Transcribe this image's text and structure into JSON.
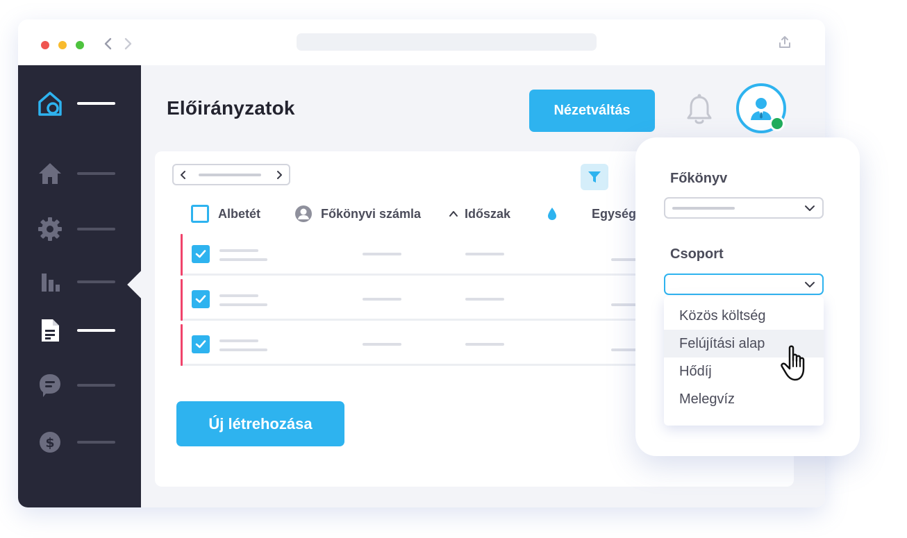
{
  "header": {
    "title": "Előirányzatok",
    "view_button": "Nézetváltás"
  },
  "sidebar": {
    "items": [
      {
        "name": "logo",
        "icon": "home-logo-icon"
      },
      {
        "name": "home",
        "icon": "house-icon"
      },
      {
        "name": "settings",
        "icon": "gear-icon"
      },
      {
        "name": "charts",
        "icon": "bar-chart-icon"
      },
      {
        "name": "documents",
        "icon": "document-icon",
        "active": true
      },
      {
        "name": "messages",
        "icon": "chat-icon"
      },
      {
        "name": "finance",
        "icon": "dollar-icon"
      }
    ]
  },
  "table": {
    "columns": [
      "Albetét",
      "Főkönyvi számla",
      "Időszak",
      "Egységk"
    ],
    "rows": [
      {
        "checked": true
      },
      {
        "checked": true
      },
      {
        "checked": true
      }
    ]
  },
  "create_button": "Új létrehozása",
  "filter_panel": {
    "ledger_label": "Főkönyv",
    "group_label": "Csoport",
    "options": [
      "Közös költség",
      "Felújítási alap",
      "Hődíj",
      "Melegvíz"
    ],
    "hovered_option": "Felújítási alap"
  },
  "colors": {
    "accent": "#2eb3ef",
    "sidebar": "#272838",
    "row_stripe": "#f0436b",
    "online": "#21ad5b"
  }
}
